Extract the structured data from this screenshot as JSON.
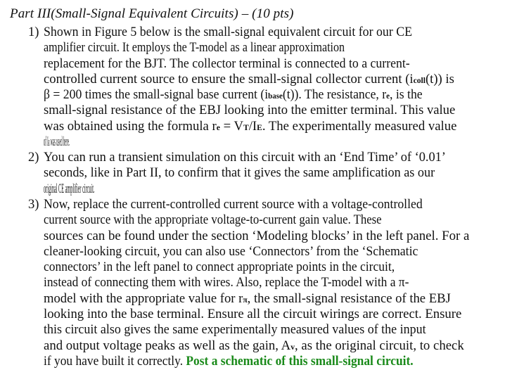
{
  "heading": "Part III(Small-Signal Equivalent Circuits) – (10 pts)",
  "items": [
    {
      "number": "1)",
      "lines": [
        [
          "Shown in Figure 5 below is the small-signal equivalent circuit for our CE"
        ],
        [
          "amplifier circuit. It employs the T-model as a linear approximation"
        ],
        [
          "replacement for the BJT. The collector terminal is connected to a current-"
        ],
        [
          "controlled current source to ensure the small-signal collector current (i",
          "coll",
          "(t)) is"
        ],
        [
          "β = 200 times the small-signal base current (i",
          "base",
          "(t)). The resistance, r",
          "e",
          ", is the"
        ],
        [
          "small-signal resistance of the EBJ looking into the emitter terminal. This value"
        ],
        [
          "was obtained using the formula r",
          "e",
          " = V",
          "T",
          "/I",
          "E",
          ". The experimentally measured value"
        ],
        [
          "of I",
          "E",
          " was used here."
        ]
      ]
    },
    {
      "number": "2)",
      "lines": [
        [
          "You can run a transient simulation on this circuit with an ‘End Time’ of ‘0.01’"
        ],
        [
          "seconds, like in Part II, to confirm that it gives the same amplification as our"
        ],
        [
          "original CE amplifier circuit."
        ]
      ]
    },
    {
      "number": "3)",
      "lines": [
        [
          "Now, replace the current-controlled current source with a voltage-controlled"
        ],
        [
          "current source with the appropriate voltage-to-current gain value. These"
        ],
        [
          "sources can be found under the section ‘Modeling blocks’ in the left panel. For a"
        ],
        [
          "cleaner-looking circuit, you can also use ‘Connectors’ from the ‘Schematic"
        ],
        [
          "connectors’ in the left panel to connect appropriate points in the circuit,"
        ],
        [
          "instead of connecting them with wires. Also, replace the T-model with a π-"
        ],
        [
          "model with the appropriate value for r",
          "π",
          ", the small-signal resistance of the EBJ"
        ],
        [
          "looking into the base terminal. Ensure all the circuit wirings are correct. Ensure"
        ],
        [
          "this circuit also gives the same experimentally measured values of the input"
        ],
        [
          "and output voltage peaks as well as the gain, A",
          "v",
          ", as the original circuit, to check"
        ],
        [
          "if you have built it correctly. "
        ]
      ],
      "highlight": "Post a schematic of this small-signal circuit."
    }
  ],
  "colors": {
    "text": "#111111",
    "highlight": "#1a8a1a"
  }
}
